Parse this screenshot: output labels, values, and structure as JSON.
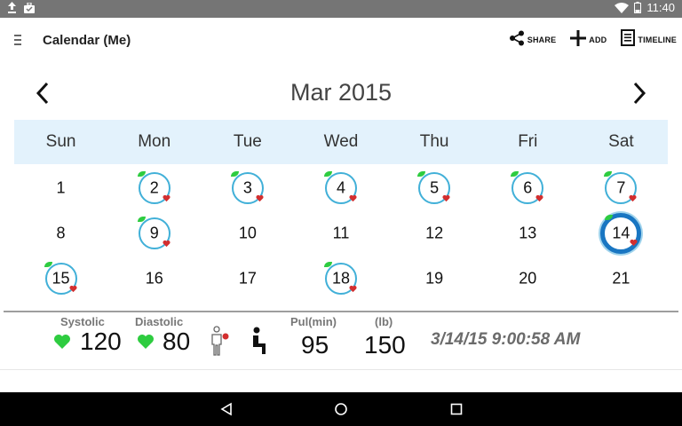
{
  "status_bar": {
    "time": "11:40",
    "icons": [
      "upload-icon",
      "briefcase-icon",
      "wifi-icon",
      "battery-icon"
    ]
  },
  "app_bar": {
    "title": "Calendar (Me)",
    "menu_icon": "menu-icon",
    "actions": [
      {
        "label": "SHARE",
        "icon": "share-icon"
      },
      {
        "label": "ADD",
        "icon": "plus-icon"
      },
      {
        "label": "TIMELINE",
        "icon": "timeline-icon"
      }
    ]
  },
  "calendar": {
    "month_label": "Mar 2015",
    "weekdays": [
      "Sun",
      "Mon",
      "Tue",
      "Wed",
      "Thu",
      "Fri",
      "Sat"
    ],
    "weeks": [
      [
        {
          "day": "1",
          "reading": false
        },
        {
          "day": "2",
          "reading": true
        },
        {
          "day": "3",
          "reading": true
        },
        {
          "day": "4",
          "reading": true
        },
        {
          "day": "5",
          "reading": true
        },
        {
          "day": "6",
          "reading": true
        },
        {
          "day": "7",
          "reading": true
        }
      ],
      [
        {
          "day": "8",
          "reading": false
        },
        {
          "day": "9",
          "reading": true
        },
        {
          "day": "10",
          "reading": false
        },
        {
          "day": "11",
          "reading": false
        },
        {
          "day": "12",
          "reading": false
        },
        {
          "day": "13",
          "reading": false
        },
        {
          "day": "14",
          "reading": true,
          "selected": true
        }
      ],
      [
        {
          "day": "15",
          "reading": true
        },
        {
          "day": "16",
          "reading": false
        },
        {
          "day": "17",
          "reading": false
        },
        {
          "day": "18",
          "reading": true
        },
        {
          "day": "19",
          "reading": false
        },
        {
          "day": "20",
          "reading": false
        },
        {
          "day": "21",
          "reading": false
        }
      ]
    ]
  },
  "reading": {
    "systolic_label": "Systolic",
    "systolic_value": "120",
    "diastolic_label": "Diastolic",
    "diastolic_value": "80",
    "pulse_label": "Pul(min)",
    "pulse_value": "95",
    "weight_label": "(lb)",
    "weight_value": "150",
    "timestamp": "3/14/15  9:00:58 AM"
  },
  "colors": {
    "heart_green": "#2ecc40",
    "heart_red": "#d32f2f",
    "ring": "#41b0d8",
    "selected_ring": "#1976c2",
    "weekday_bg": "#e3f2fc"
  }
}
